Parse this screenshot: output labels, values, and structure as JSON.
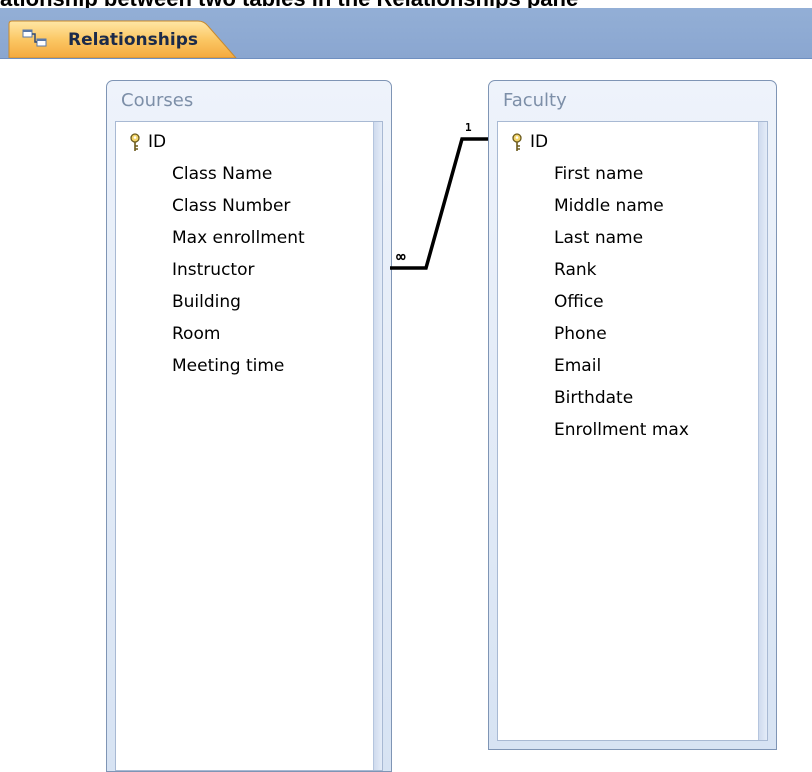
{
  "caption_text": "ationship between two tables in the Relationships pane",
  "tab": {
    "label": "Relationships",
    "icon": "relationships-icon"
  },
  "tables": [
    {
      "name": "Courses",
      "fields": [
        {
          "label": "ID",
          "primary_key": true
        },
        {
          "label": "Class Name"
        },
        {
          "label": "Class Number"
        },
        {
          "label": "Max enrollment"
        },
        {
          "label": "Instructor"
        },
        {
          "label": "Building"
        },
        {
          "label": "Room"
        },
        {
          "label": "Meeting time"
        }
      ]
    },
    {
      "name": "Faculty",
      "fields": [
        {
          "label": "ID",
          "primary_key": true
        },
        {
          "label": "First name"
        },
        {
          "label": "Middle name"
        },
        {
          "label": "Last name"
        },
        {
          "label": "Rank"
        },
        {
          "label": "Office"
        },
        {
          "label": "Phone"
        },
        {
          "label": "Email"
        },
        {
          "label": "Birthdate"
        },
        {
          "label": "Enrollment max"
        }
      ]
    }
  ],
  "relationship": {
    "from_table": "Courses",
    "from_field": "Instructor",
    "from_cardinality": "∞",
    "to_table": "Faculty",
    "to_field": "ID",
    "to_cardinality": "1"
  },
  "colors": {
    "tab_bar": "#8aa6d0",
    "tab_active": "#f7b24a",
    "table_title": "#7d8fa8",
    "table_border": "#7f95b5"
  }
}
